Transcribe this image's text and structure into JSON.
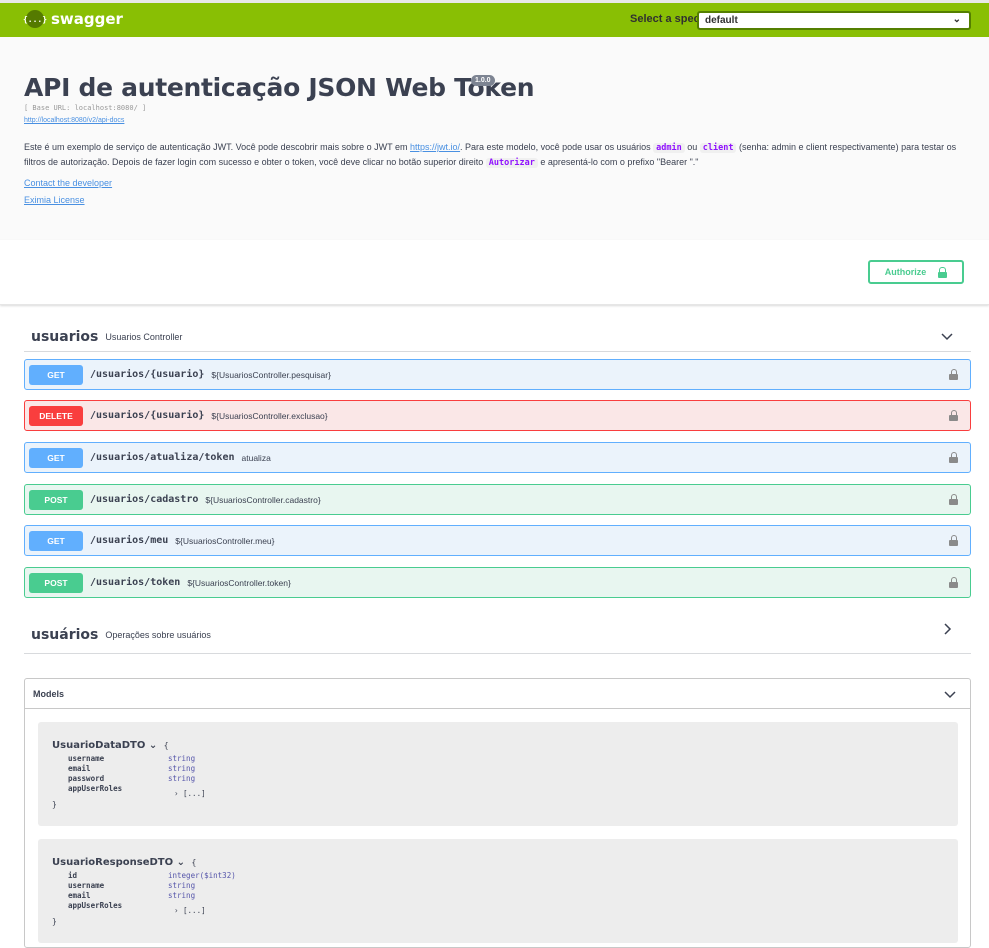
{
  "topbar": {
    "logo_symbol": "{...}",
    "logo_text": "swagger",
    "spec_label": "Select a spec",
    "spec_value": "default"
  },
  "info": {
    "title": "API de autenticação JSON Web Token",
    "version": "1.0.0",
    "base_url": "[ Base URL: localhost:8080/ ]",
    "api_docs_link": "http://localhost:8080/v2/api-docs",
    "desc_1": "Este é um exemplo de serviço de autenticação JWT. Você pode descobrir mais sobre o JWT em ",
    "jwt_link": "https://jwt.io/",
    "desc_2": ". Para este modelo, você pode usar os usuários ",
    "code_admin": "admin",
    "desc_3": " ou ",
    "code_client": "client",
    "desc_4": " (senha: admin e client respectivamente) para testar os filtros de autorização. Depois de fazer login com sucesso e obter o token, você deve clicar no botão superior direito ",
    "code_autorizar": "Autorizar",
    "desc_5": " e apresentá-lo com o prefixo \"Bearer \".\"",
    "contact": "Contact the developer",
    "license": "Eximia License"
  },
  "authorize_label": "Authorize",
  "tags": [
    {
      "name": "usuarios",
      "description": "Usuarios Controller"
    },
    {
      "name": "usuários",
      "description": "Operações sobre usuários"
    }
  ],
  "operations": [
    {
      "method": "GET",
      "path": "/usuarios/{usuario}",
      "summary": "${UsuariosController.pesquisar}"
    },
    {
      "method": "DELETE",
      "path": "/usuarios/{usuario}",
      "summary": "${UsuariosController.exclusao}"
    },
    {
      "method": "GET",
      "path": "/usuarios/atualiza/token",
      "summary": "atualiza"
    },
    {
      "method": "POST",
      "path": "/usuarios/cadastro",
      "summary": "${UsuariosController.cadastro}"
    },
    {
      "method": "GET",
      "path": "/usuarios/meu",
      "summary": "${UsuariosController.meu}"
    },
    {
      "method": "POST",
      "path": "/usuarios/token",
      "summary": "${UsuariosController.token}"
    }
  ],
  "models": {
    "title": "Models",
    "items": [
      {
        "name": "UsuarioDataDTO",
        "open_brace": "{",
        "close_brace": "}",
        "props": [
          {
            "name": "username",
            "type": "string"
          },
          {
            "name": "email",
            "type": "string"
          },
          {
            "name": "password",
            "type": "string"
          },
          {
            "name": "appUserRoles",
            "type": "[...]"
          }
        ]
      },
      {
        "name": "UsuarioResponseDTO",
        "open_brace": "{",
        "close_brace": "}",
        "props": [
          {
            "name": "id",
            "type": "integer($int32)"
          },
          {
            "name": "username",
            "type": "string"
          },
          {
            "name": "email",
            "type": "string"
          },
          {
            "name": "appUserRoles",
            "type": "[...]"
          }
        ]
      }
    ]
  },
  "colors": {
    "topbar": "#89bf04",
    "get": "#61affe",
    "delete": "#f93e3e",
    "post": "#49cc90",
    "link": "#4990e2"
  }
}
